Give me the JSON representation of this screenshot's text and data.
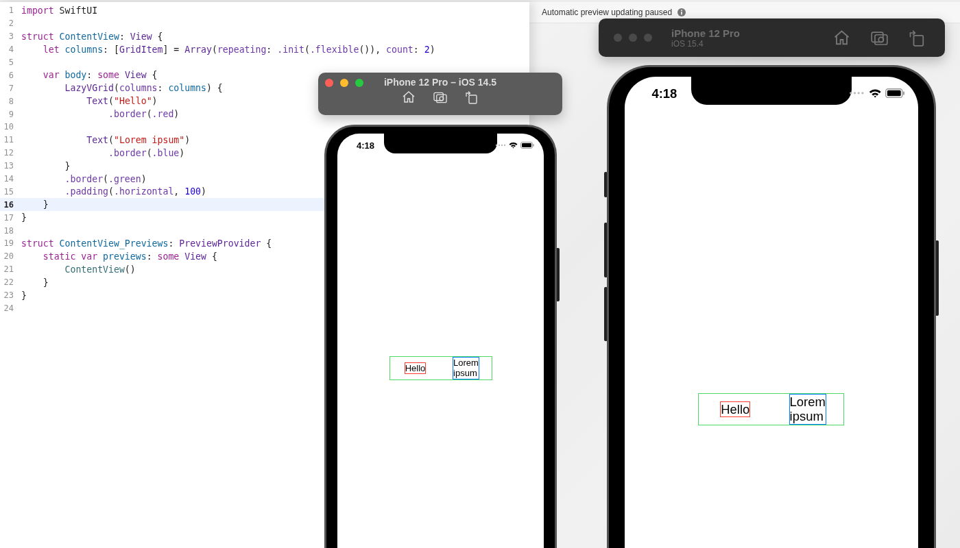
{
  "editor": {
    "lines": [
      {
        "number": "1",
        "current": false,
        "tokens": [
          {
            "text": "import",
            "kind": "kw"
          },
          {
            "text": " SwiftUI",
            "kind": "plain"
          }
        ]
      },
      {
        "number": "2",
        "current": false
      },
      {
        "number": "3",
        "current": false,
        "tokens": [
          {
            "text": "struct",
            "kind": "kw"
          },
          {
            "text": " ContentView",
            "kind": "decl"
          },
          {
            "text": ": ",
            "kind": "plain"
          },
          {
            "text": "View",
            "kind": "type"
          },
          {
            "text": " {",
            "kind": "plain"
          }
        ]
      },
      {
        "number": "4",
        "current": false,
        "tokens": [
          {
            "text": "    let",
            "kind": "kw"
          },
          {
            "text": " columns",
            "kind": "decl"
          },
          {
            "text": ": [",
            "kind": "plain"
          },
          {
            "text": "GridItem",
            "kind": "type"
          },
          {
            "text": "] = ",
            "kind": "plain"
          },
          {
            "text": "Array",
            "kind": "type"
          },
          {
            "text": "(",
            "kind": "plain"
          },
          {
            "text": "repeating",
            "kind": "member"
          },
          {
            "text": ": ",
            "kind": "plain"
          },
          {
            "text": ".init",
            "kind": "member"
          },
          {
            "text": "(",
            "kind": "plain"
          },
          {
            "text": ".flexible",
            "kind": "member"
          },
          {
            "text": "()), ",
            "kind": "plain"
          },
          {
            "text": "count",
            "kind": "member"
          },
          {
            "text": ": ",
            "kind": "plain"
          },
          {
            "text": "2",
            "kind": "number"
          },
          {
            "text": ")",
            "kind": "plain"
          }
        ]
      },
      {
        "number": "5",
        "current": false
      },
      {
        "number": "6",
        "current": false,
        "tokens": [
          {
            "text": "    var",
            "kind": "kw"
          },
          {
            "text": " body",
            "kind": "decl"
          },
          {
            "text": ": ",
            "kind": "plain"
          },
          {
            "text": "some",
            "kind": "kw"
          },
          {
            "text": " View",
            "kind": "type"
          },
          {
            "text": " {",
            "kind": "plain"
          }
        ]
      },
      {
        "number": "7",
        "current": false,
        "tokens": [
          {
            "text": "        LazyVGrid",
            "kind": "type"
          },
          {
            "text": "(",
            "kind": "plain"
          },
          {
            "text": "columns",
            "kind": "member"
          },
          {
            "text": ": ",
            "kind": "plain"
          },
          {
            "text": "columns",
            "kind": "decl"
          },
          {
            "text": ") {",
            "kind": "plain"
          }
        ]
      },
      {
        "number": "8",
        "current": false,
        "tokens": [
          {
            "text": "            Text",
            "kind": "type"
          },
          {
            "text": "(",
            "kind": "plain"
          },
          {
            "text": "\"Hello\"",
            "kind": "string"
          },
          {
            "text": ")",
            "kind": "plain"
          }
        ]
      },
      {
        "number": "9",
        "current": false,
        "tokens": [
          {
            "text": "                .border",
            "kind": "member"
          },
          {
            "text": "(",
            "kind": "plain"
          },
          {
            "text": ".red",
            "kind": "member"
          },
          {
            "text": ")",
            "kind": "plain"
          }
        ]
      },
      {
        "number": "10",
        "current": false
      },
      {
        "number": "11",
        "current": false,
        "tokens": [
          {
            "text": "            Text",
            "kind": "type"
          },
          {
            "text": "(",
            "kind": "plain"
          },
          {
            "text": "\"Lorem ipsum\"",
            "kind": "string"
          },
          {
            "text": ")",
            "kind": "plain"
          }
        ]
      },
      {
        "number": "12",
        "current": false,
        "tokens": [
          {
            "text": "                .border",
            "kind": "member"
          },
          {
            "text": "(",
            "kind": "plain"
          },
          {
            "text": ".blue",
            "kind": "member"
          },
          {
            "text": ")",
            "kind": "plain"
          }
        ]
      },
      {
        "number": "13",
        "current": false,
        "tokens": [
          {
            "text": "        }",
            "kind": "plain"
          }
        ]
      },
      {
        "number": "14",
        "current": false,
        "tokens": [
          {
            "text": "        .border",
            "kind": "member"
          },
          {
            "text": "(",
            "kind": "plain"
          },
          {
            "text": ".green",
            "kind": "member"
          },
          {
            "text": ")",
            "kind": "plain"
          }
        ]
      },
      {
        "number": "15",
        "current": false,
        "tokens": [
          {
            "text": "        .padding",
            "kind": "member"
          },
          {
            "text": "(",
            "kind": "plain"
          },
          {
            "text": ".horizontal",
            "kind": "member"
          },
          {
            "text": ", ",
            "kind": "plain"
          },
          {
            "text": "100",
            "kind": "number"
          },
          {
            "text": ")",
            "kind": "plain"
          }
        ]
      },
      {
        "number": "16",
        "current": true,
        "tokens": [
          {
            "text": "    }",
            "kind": "plain"
          }
        ]
      },
      {
        "number": "17",
        "current": false,
        "tokens": [
          {
            "text": "}",
            "kind": "plain"
          }
        ]
      },
      {
        "number": "18",
        "current": false
      },
      {
        "number": "19",
        "current": false,
        "tokens": [
          {
            "text": "struct",
            "kind": "kw"
          },
          {
            "text": " ContentView_Previews",
            "kind": "decl"
          },
          {
            "text": ": ",
            "kind": "plain"
          },
          {
            "text": "PreviewProvider",
            "kind": "type"
          },
          {
            "text": " {",
            "kind": "plain"
          }
        ]
      },
      {
        "number": "20",
        "current": false,
        "tokens": [
          {
            "text": "    static var",
            "kind": "kw"
          },
          {
            "text": " previews",
            "kind": "decl"
          },
          {
            "text": ": ",
            "kind": "plain"
          },
          {
            "text": "some",
            "kind": "kw"
          },
          {
            "text": " View",
            "kind": "type"
          },
          {
            "text": " {",
            "kind": "plain"
          }
        ]
      },
      {
        "number": "21",
        "current": false,
        "tokens": [
          {
            "text": "        ContentView",
            "kind": "local"
          },
          {
            "text": "()",
            "kind": "plain"
          }
        ]
      },
      {
        "number": "22",
        "current": false,
        "tokens": [
          {
            "text": "    }",
            "kind": "plain"
          }
        ]
      },
      {
        "number": "23",
        "current": false,
        "tokens": [
          {
            "text": "}",
            "kind": "plain"
          }
        ]
      },
      {
        "number": "24",
        "current": false
      }
    ]
  },
  "preview": {
    "status": "Automatic preview updating paused"
  },
  "simulators": [
    {
      "title": "iPhone 12 Pro – iOS 14.5",
      "active": true,
      "time": "4:18",
      "cells": [
        {
          "text": "Hello",
          "color": "#ff3b30"
        },
        {
          "text": "Lorem ipsum",
          "color": "#007aff"
        }
      ]
    },
    {
      "title": "iPhone 12 Pro",
      "subtitle": "iOS 15.4",
      "active": false,
      "time": "4:18",
      "cells": [
        {
          "text": "Hello",
          "color": "#ff3b30"
        },
        {
          "text": "Lorem ipsum",
          "color": "#007aff"
        }
      ]
    }
  ]
}
